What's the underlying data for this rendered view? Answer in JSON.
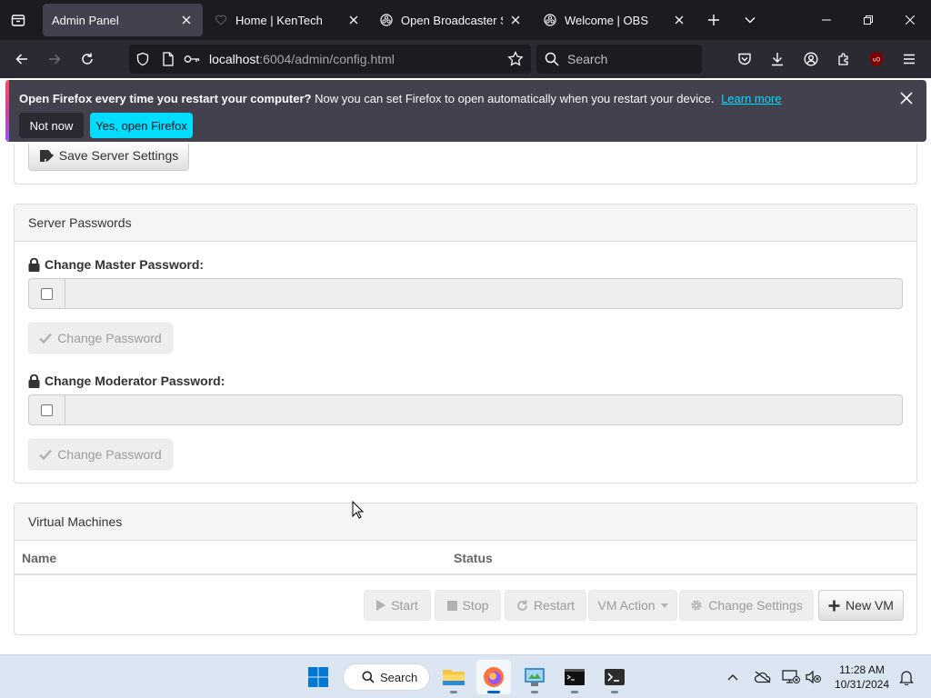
{
  "browser": {
    "tabs": [
      {
        "title": "Admin Panel",
        "active": true
      },
      {
        "title": "Home | KenTech",
        "active": false
      },
      {
        "title": "Open Broadcaster Softw",
        "active": false
      },
      {
        "title": "Welcome | OBS",
        "active": false
      }
    ],
    "url": {
      "host": "localhost",
      "rest": ":6004/admin/config.html"
    },
    "search_placeholder": "Search"
  },
  "notification": {
    "bold": "Open Firefox every time you restart your computer?",
    "text": "Now you can set Firefox to open automatically when you restart your device.",
    "link": "Learn more",
    "not_now": "Not now",
    "yes": "Yes, open Firefox"
  },
  "server_settings": {
    "save_label": "Save Server Settings"
  },
  "passwords": {
    "heading": "Server Passwords",
    "master_label": "Change Master Password:",
    "moderator_label": "Change Moderator Password:",
    "change_label": "Change Password"
  },
  "vms": {
    "heading": "Virtual Machines",
    "columns": [
      "Name",
      "Status"
    ],
    "buttons": {
      "start": "Start",
      "stop": "Stop",
      "restart": "Restart",
      "action": "VM Action",
      "settings": "Change Settings",
      "new": "New VM"
    }
  },
  "taskbar": {
    "search": "Search",
    "time": "11:28 AM",
    "date": "10/31/2024"
  }
}
